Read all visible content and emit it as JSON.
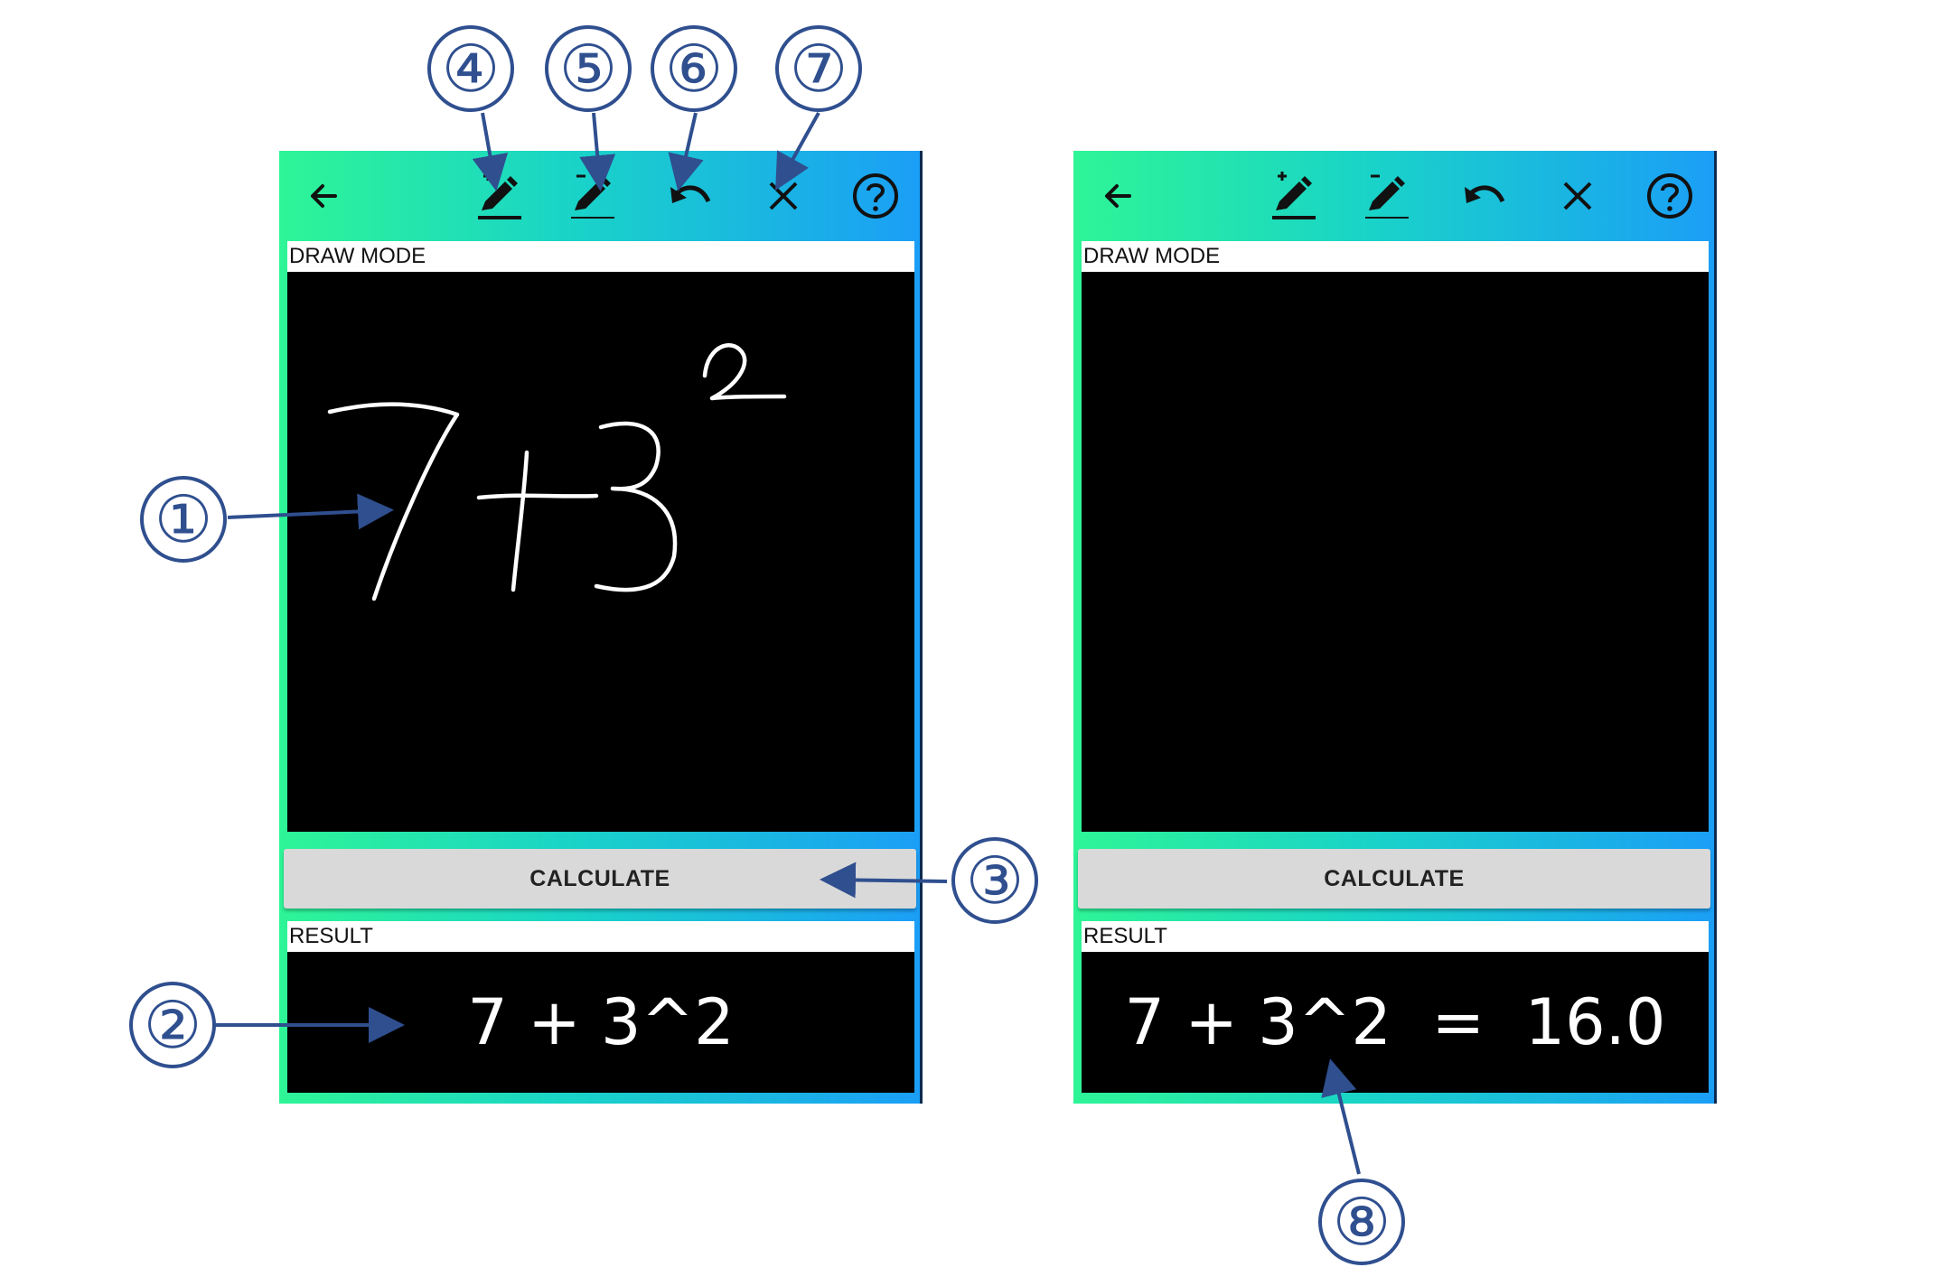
{
  "colors": {
    "accent": "#2f4f8f",
    "gradient_start": "#2ef596",
    "gradient_end": "#1b9ef7"
  },
  "icons": [
    "back-arrow-icon",
    "pen-plus-icon",
    "pen-minus-icon",
    "undo-icon",
    "close-icon",
    "help-icon"
  ],
  "left_screen": {
    "draw_mode_label": "DRAW MODE",
    "handwriting": "7+3²",
    "calculate_label": "CALCULATE",
    "result_label": "RESULT",
    "result_text": "7 + 3^2"
  },
  "right_screen": {
    "draw_mode_label": "DRAW MODE",
    "calculate_label": "CALCULATE",
    "result_label": "RESULT",
    "result_text": "7 + 3^2  =  16.0"
  },
  "callouts": {
    "c1": "①",
    "c2": "②",
    "c3": "③",
    "c4": "④",
    "c5": "⑤",
    "c6": "⑥",
    "c7": "⑦",
    "c8": "⑧"
  }
}
